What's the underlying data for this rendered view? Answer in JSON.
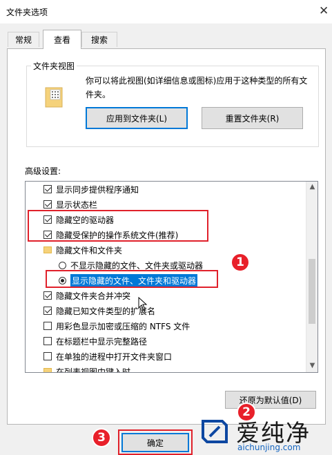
{
  "window": {
    "title": "文件夹选项",
    "close_glyph": "✕"
  },
  "tabs": [
    {
      "label": "常规"
    },
    {
      "label": "查看"
    },
    {
      "label": "搜索"
    }
  ],
  "folder_views": {
    "group_label": "文件夹视图",
    "description": "你可以将此视图(如详细信息或图标)应用于这种类型的所有文件夹。",
    "apply_button": "应用到文件夹(L)",
    "reset_button": "重置文件夹(R)"
  },
  "advanced": {
    "label": "高级设置:",
    "items": [
      {
        "type": "checkbox",
        "checked": true,
        "label": "显示同步提供程序通知"
      },
      {
        "type": "checkbox",
        "checked": true,
        "label": "显示状态栏"
      },
      {
        "type": "checkbox",
        "checked": true,
        "label": "隐藏空的驱动器"
      },
      {
        "type": "checkbox",
        "checked": true,
        "label": "隐藏受保护的操作系统文件(推荐)"
      },
      {
        "type": "folder",
        "label": "隐藏文件和文件夹"
      },
      {
        "type": "radio",
        "checked": false,
        "label": "不显示隐藏的文件、文件夹或驱动器"
      },
      {
        "type": "radio",
        "checked": true,
        "label": "显示隐藏的文件、文件夹和驱动器"
      },
      {
        "type": "checkbox",
        "checked": true,
        "label": "隐藏文件夹合并冲突"
      },
      {
        "type": "checkbox",
        "checked": true,
        "label": "隐藏已知文件类型的扩展名"
      },
      {
        "type": "checkbox",
        "checked": false,
        "label": "用彩色显示加密或压缩的 NTFS 文件"
      },
      {
        "type": "checkbox",
        "checked": false,
        "label": "在标题栏中显示完整路径"
      },
      {
        "type": "checkbox",
        "checked": false,
        "label": "在单独的进程中打开文件夹窗口"
      },
      {
        "type": "folder",
        "label": "在列表视图中键入时"
      }
    ],
    "restore_button": "还原为默认值(D)"
  },
  "footer": {
    "ok_button": "确定"
  },
  "annotations": {
    "badge_1": "1",
    "badge_2": "2",
    "badge_3": "3"
  },
  "watermark": {
    "text": "爱纯净",
    "url": "aichunjing.com"
  },
  "colors": {
    "accent": "#0078d7",
    "highlight": "#e0202a"
  }
}
